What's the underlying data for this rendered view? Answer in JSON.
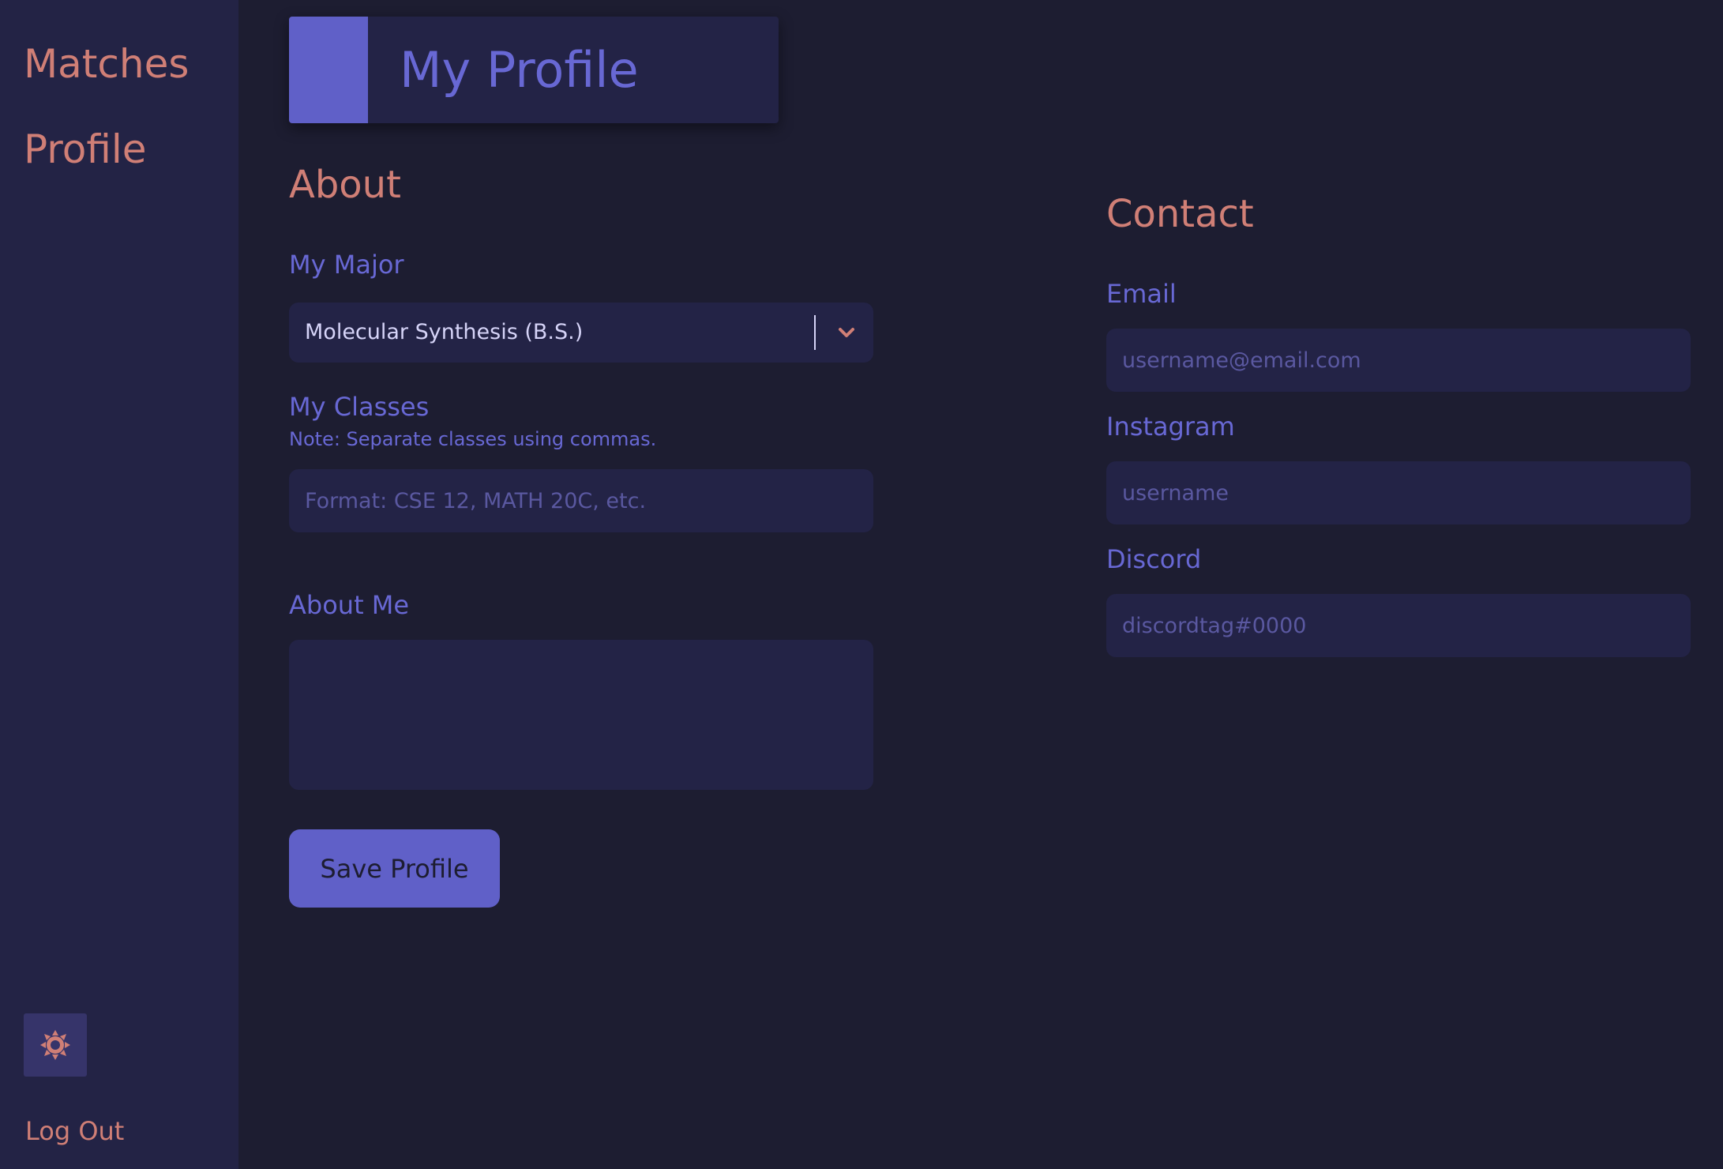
{
  "colors": {
    "background": "#1d1d31",
    "sidebar": "#232345",
    "accent_purple": "#6060c8",
    "accent_salmon": "#d07f76",
    "field_bg": "#232346"
  },
  "sidebar": {
    "items": [
      {
        "label": "Matches"
      },
      {
        "label": "Profile"
      }
    ],
    "theme_toggle_icon": "sun-icon",
    "logout_label": "Log Out"
  },
  "header": {
    "title": "My Profile"
  },
  "about": {
    "title": "About",
    "major": {
      "label": "My Major",
      "selected": "Molecular Synthesis (B.S.)"
    },
    "classes": {
      "label": "My Classes",
      "note": "Note: Separate classes using commas.",
      "placeholder": "Format: CSE 12, MATH 20C, etc.",
      "value": ""
    },
    "about_me": {
      "label": "About Me",
      "value": ""
    },
    "save_label": "Save Profile"
  },
  "contact": {
    "title": "Contact",
    "email": {
      "label": "Email",
      "placeholder": "username@email.com"
    },
    "instagram": {
      "label": "Instagram",
      "placeholder": "username"
    },
    "discord": {
      "label": "Discord",
      "placeholder": "discordtag#0000"
    }
  }
}
